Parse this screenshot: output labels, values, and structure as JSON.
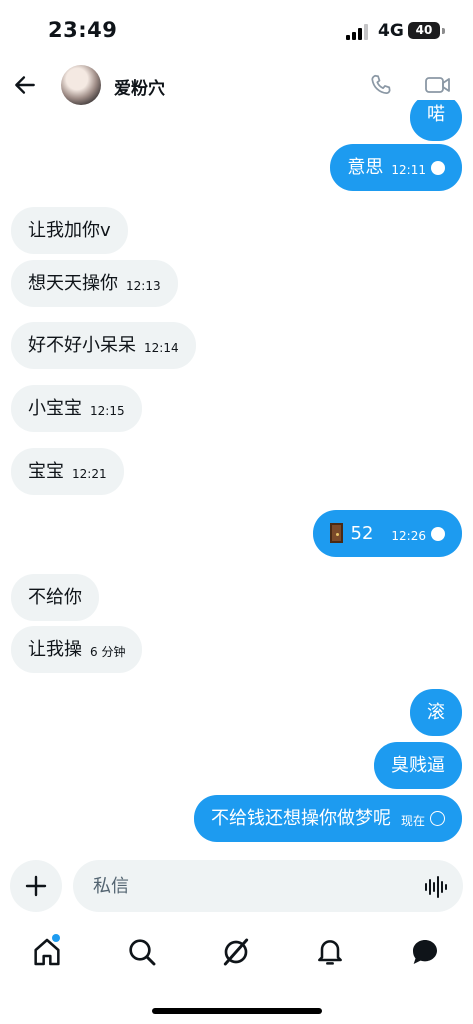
{
  "status_bar": {
    "time": "23:49",
    "network": "4G",
    "battery": "40"
  },
  "header": {
    "contact_name": "爱粉穴"
  },
  "messages": [
    {
      "side": "out",
      "text": "喏",
      "time": ""
    },
    {
      "side": "out",
      "text": "意思",
      "time": "12:11",
      "receipt": "read"
    },
    {
      "side": "in",
      "text": "让我加你v",
      "time": ""
    },
    {
      "side": "in",
      "text": "想天天操你",
      "time": "12:13"
    },
    {
      "side": "in",
      "text": "好不好小呆呆",
      "time": "12:14"
    },
    {
      "side": "in",
      "text": "小宝宝",
      "time": "12:15"
    },
    {
      "side": "in",
      "text": "宝宝",
      "time": "12:21"
    },
    {
      "side": "out",
      "text": "52",
      "time": "12:26",
      "emoji": "door-emoji",
      "receipt": "read"
    },
    {
      "side": "in",
      "text": "不给你",
      "time": ""
    },
    {
      "side": "in",
      "text": "让我操",
      "time": "6 分钟"
    },
    {
      "side": "out",
      "text": "滚",
      "time": ""
    },
    {
      "side": "out",
      "text": "臭贱逼",
      "time": ""
    },
    {
      "side": "out",
      "text": "不给钱还想操你做梦呢",
      "time": "现在",
      "receipt": "sent"
    }
  ],
  "composer": {
    "placeholder": "私信"
  },
  "tabbar": {
    "items": [
      "home-icon",
      "search-icon",
      "grok-icon",
      "notifications-icon",
      "messages-icon"
    ],
    "home_has_badge": true
  },
  "colors": {
    "accent": "#1d9bf0",
    "incoming_bubble": "#eff3f4",
    "text": "#0f1419"
  }
}
